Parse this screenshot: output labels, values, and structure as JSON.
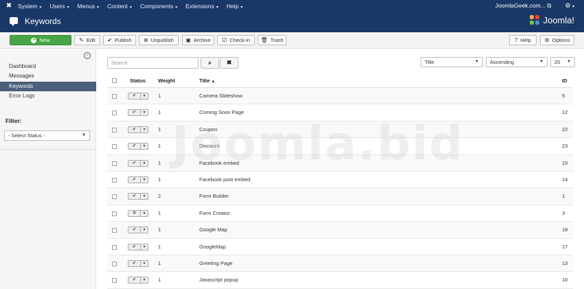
{
  "topmenu": {
    "items": [
      {
        "label": "System"
      },
      {
        "label": "Users"
      },
      {
        "label": "Menus"
      },
      {
        "label": "Content"
      },
      {
        "label": "Components"
      },
      {
        "label": "Extensions"
      },
      {
        "label": "Help"
      }
    ],
    "site_link": "JoomlaGeek.com...",
    "site_link_icon": "external-link-icon",
    "gear_icon": "gear-icon"
  },
  "titlebar": {
    "title": "Keywords",
    "brand": "Joomla!"
  },
  "toolbar": {
    "new": "New",
    "edit": "Edit",
    "publish": "Publish",
    "unpublish": "Unpublish",
    "archive": "Archive",
    "checkin": "Check-in",
    "trash": "Trash",
    "help": "Help",
    "options": "Options"
  },
  "sidebar": {
    "items": [
      {
        "label": "Dashboard"
      },
      {
        "label": "Messages"
      },
      {
        "label": "Keywords",
        "active": true
      },
      {
        "label": "Error Logs"
      }
    ],
    "filter_label": "Filter:",
    "status_select": "- Select Status -"
  },
  "filters": {
    "search_placeholder": "Search",
    "sort_field": "Title",
    "sort_direction": "Ascending",
    "limit": "20"
  },
  "table": {
    "headers": {
      "status": "Status",
      "weight": "Weight",
      "title": "Title",
      "id": "ID"
    },
    "rows": [
      {
        "weight": "1",
        "title": "Camera Slideshow",
        "id": "5",
        "status": "published"
      },
      {
        "weight": "1",
        "title": "Coming Soon Page",
        "id": "12",
        "status": "published"
      },
      {
        "weight": "1",
        "title": "Coupon",
        "id": "22",
        "status": "published"
      },
      {
        "weight": "1",
        "title": "Discount",
        "id": "23",
        "status": "published"
      },
      {
        "weight": "1",
        "title": "Facebook embed",
        "id": "15",
        "status": "published"
      },
      {
        "weight": "1",
        "title": "Facebook post embed",
        "id": "14",
        "status": "published"
      },
      {
        "weight": "2",
        "title": "Form Builder",
        "id": "1",
        "status": "published"
      },
      {
        "weight": "1",
        "title": "Form Creator",
        "id": "3",
        "status": "other"
      },
      {
        "weight": "1",
        "title": "Google Map",
        "id": "18",
        "status": "published"
      },
      {
        "weight": "1",
        "title": "GoogleMap",
        "id": "17",
        "status": "published"
      },
      {
        "weight": "1",
        "title": "Greeting Page",
        "id": "13",
        "status": "published"
      },
      {
        "weight": "1",
        "title": "Javascript popup",
        "id": "10",
        "status": "published"
      }
    ]
  },
  "watermark": "Joomla.bid",
  "colors": {
    "header_bg": "#1a3867",
    "new_button": "#46a546",
    "active_nav": "#4a5f79"
  }
}
